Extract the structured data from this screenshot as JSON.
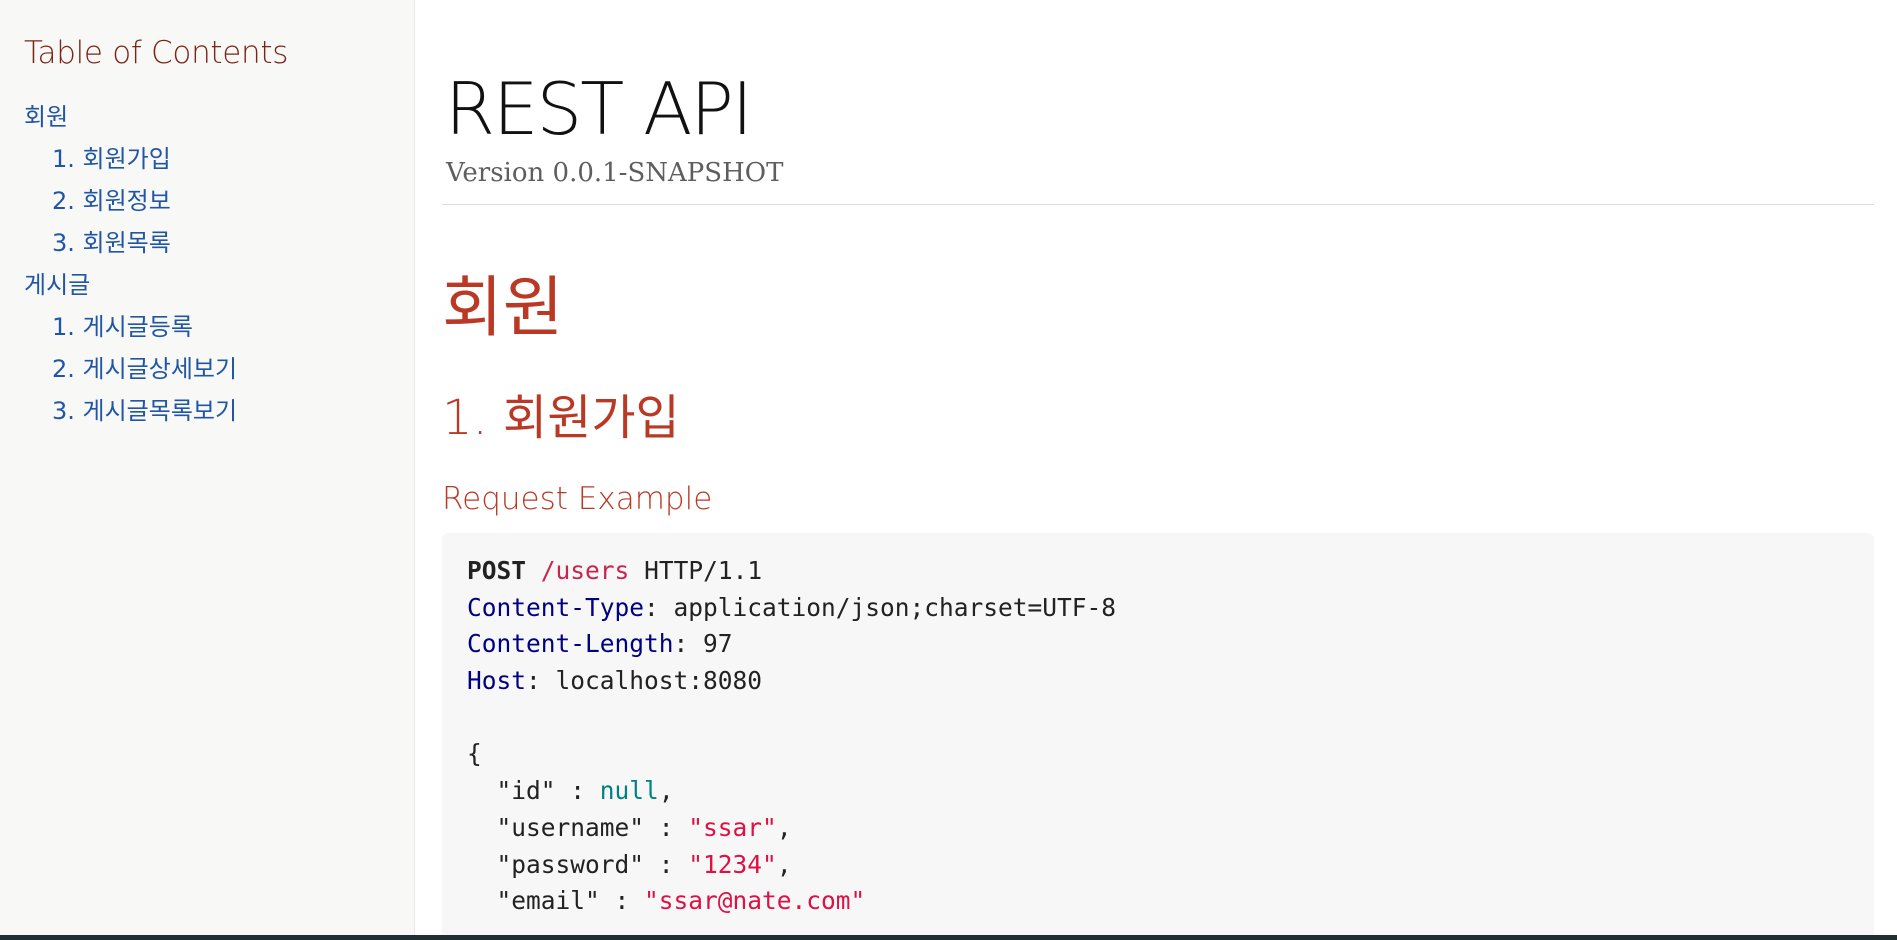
{
  "toc": {
    "title": "Table of Contents",
    "items": [
      {
        "label": "회원",
        "level": 1
      },
      {
        "label": "1. 회원가입",
        "level": 2
      },
      {
        "label": "2. 회원정보",
        "level": 2
      },
      {
        "label": "3. 회원목록",
        "level": 2
      },
      {
        "label": "게시글",
        "level": 1
      },
      {
        "label": "1. 게시글등록",
        "level": 2
      },
      {
        "label": "2. 게시글상세보기",
        "level": 2
      },
      {
        "label": "3. 게시글목록보기",
        "level": 2
      }
    ]
  },
  "doc": {
    "title": "REST API",
    "version": "Version 0.0.1-SNAPSHOT"
  },
  "section": {
    "title": "회원",
    "subsection": "1. 회원가입",
    "example_heading": "Request Example"
  },
  "request": {
    "method": "POST",
    "path": "/users",
    "protocol": "HTTP/1.1",
    "headers": [
      {
        "name": "Content-Type",
        "value": "application/json;charset=UTF-8"
      },
      {
        "name": "Content-Length",
        "value": "97"
      },
      {
        "name": "Host",
        "value": "localhost:8080"
      }
    ],
    "body_open": "{",
    "fields": [
      {
        "key": "\"id\"",
        "value": "null",
        "type": "null",
        "trail": ","
      },
      {
        "key": "\"username\"",
        "value": "\"ssar\"",
        "type": "string",
        "trail": ","
      },
      {
        "key": "\"password\"",
        "value": "\"1234\"",
        "type": "string",
        "trail": ","
      },
      {
        "key": "\"email\"",
        "value": "\"ssar@nate.com\"",
        "type": "string",
        "trail": ""
      }
    ]
  },
  "colors": {
    "heading": "#ba3925",
    "toc_title": "#7a2518",
    "link": "#2156a5",
    "header_key": "#000080",
    "string": "#d14",
    "null": "#008080"
  }
}
